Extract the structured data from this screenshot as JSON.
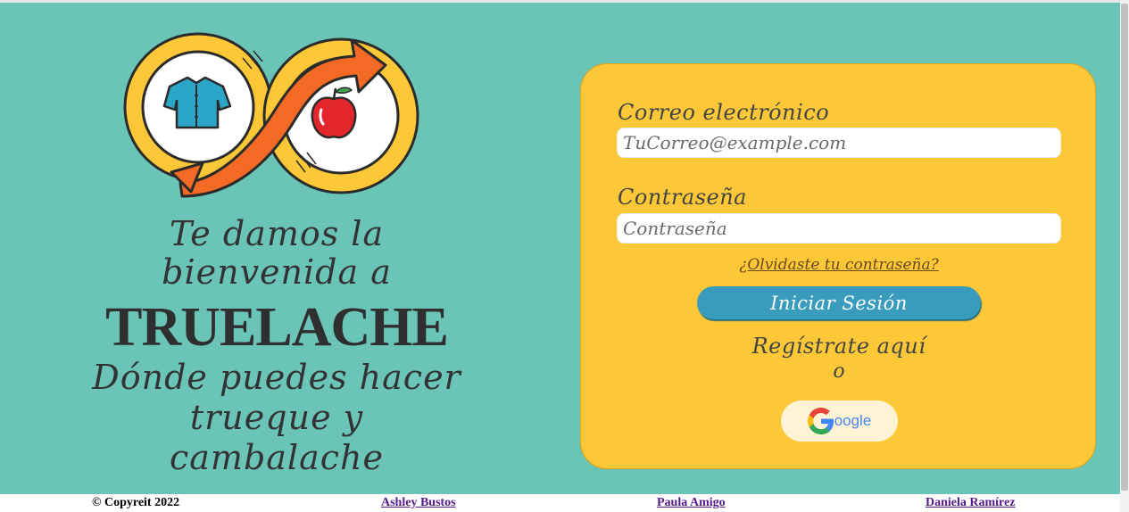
{
  "welcome": {
    "line1": "Te damos la",
    "line2": "bienvenida a",
    "brand": "TRUELACHE",
    "line3": "Dónde puedes hacer",
    "line4": "trueque y",
    "line5": "cambalache"
  },
  "login": {
    "email_label": "Correo electrónico",
    "email_placeholder": "TuCorreo@example.com",
    "password_label": "Contraseña",
    "password_placeholder": "Contraseña",
    "forgot_link": "¿Olvidaste tu contraseña?",
    "submit_label": "Iniciar Sesión",
    "register_link": "Regístrate aquí",
    "or_text": "o",
    "google_label": "oogle"
  },
  "footer": {
    "copyright": "© Copyreit 2022",
    "authors": [
      "Ashley Bustos",
      "Paula Amigo",
      "Daniela Ramírez"
    ]
  },
  "colors": {
    "background": "#6bc5b7",
    "card": "#fdc837",
    "button": "#3a9cbd",
    "arrow": "#f26a24"
  },
  "icons": {
    "logo": "shirt-apple-exchange-logo",
    "google": "google-g-icon"
  }
}
